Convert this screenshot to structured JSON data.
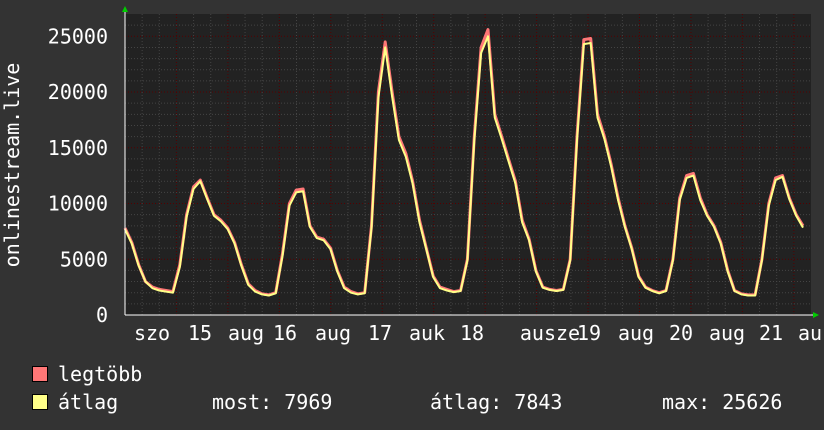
{
  "chart_data": {
    "type": "line",
    "ylabel": "onlinestream.live",
    "ylim": [
      0,
      27000
    ],
    "y_ticks": [
      0,
      5000,
      10000,
      15000,
      20000,
      25000
    ],
    "x_tick_labels": [
      "szo",
      "15",
      "aug",
      "16",
      "aug",
      "17",
      "auk",
      "18",
      "ausze",
      "19",
      "aug",
      "20",
      "aug",
      "21",
      "au"
    ],
    "grid": true,
    "series": [
      {
        "name": "legtöbb",
        "color": "#ff7777",
        "values": [
          7800,
          6500,
          4500,
          3000,
          2500,
          2300,
          2200,
          2100,
          4500,
          9000,
          11500,
          12100,
          10500,
          9000,
          8500,
          7800,
          6500,
          4500,
          2800,
          2200,
          1900,
          1800,
          2000,
          5500,
          10000,
          11200,
          11300,
          8000,
          7000,
          6800,
          6000,
          4000,
          2500,
          2100,
          1900,
          2000,
          8000,
          20000,
          24500,
          20000,
          16000,
          14500,
          12000,
          8500,
          6000,
          3500,
          2500,
          2300,
          2100,
          2200,
          5000,
          16000,
          24000,
          25600,
          18000,
          16000,
          14000,
          12000,
          8500,
          6800,
          4000,
          2500,
          2300,
          2200,
          2300,
          5000,
          16000,
          24700,
          24800,
          18000,
          16000,
          13500,
          10500,
          8000,
          6000,
          3500,
          2500,
          2200,
          2000,
          2200,
          5000,
          10500,
          12500,
          12700,
          10500,
          9000,
          8000,
          6500,
          4000,
          2200,
          1900,
          1800,
          1800,
          5000,
          10000,
          12300,
          12500,
          10500,
          9000,
          8000
        ]
      },
      {
        "name": "átlag",
        "color": "#ffff88",
        "values": [
          7700,
          6400,
          4400,
          3000,
          2400,
          2200,
          2100,
          2000,
          4300,
          8800,
          11300,
          12000,
          10400,
          8900,
          8400,
          7700,
          6400,
          4400,
          2700,
          2100,
          1850,
          1750,
          1950,
          5300,
          9800,
          11000,
          11100,
          7900,
          6900,
          6700,
          5900,
          3900,
          2400,
          2000,
          1850,
          1950,
          7800,
          19500,
          24000,
          19600,
          15700,
          14200,
          11800,
          8300,
          5900,
          3400,
          2400,
          2200,
          2050,
          2150,
          4900,
          15700,
          23500,
          25000,
          17700,
          15800,
          13800,
          11800,
          8300,
          6700,
          3900,
          2450,
          2250,
          2150,
          2250,
          4900,
          15700,
          24300,
          24400,
          17700,
          15800,
          13300,
          10300,
          7900,
          5900,
          3400,
          2450,
          2150,
          1950,
          2150,
          4900,
          10300,
          12300,
          12500,
          10300,
          8900,
          7900,
          6400,
          3900,
          2150,
          1850,
          1750,
          1750,
          4900,
          9800,
          12100,
          12400,
          10400,
          8900,
          7843
        ]
      }
    ]
  },
  "legend": {
    "items": [
      {
        "label": "legtöbb",
        "color": "#ff7777"
      },
      {
        "label": "átlag",
        "color": "#ffff88"
      }
    ],
    "stats": {
      "now": "most: 7969",
      "avg": "átlag: 7843",
      "max": "max: 25626"
    }
  },
  "colors": {
    "background": "#333333",
    "plot_background": "#222222",
    "grid_major": "#550000",
    "grid_minor": "#444444",
    "axis": "#00cc00"
  }
}
